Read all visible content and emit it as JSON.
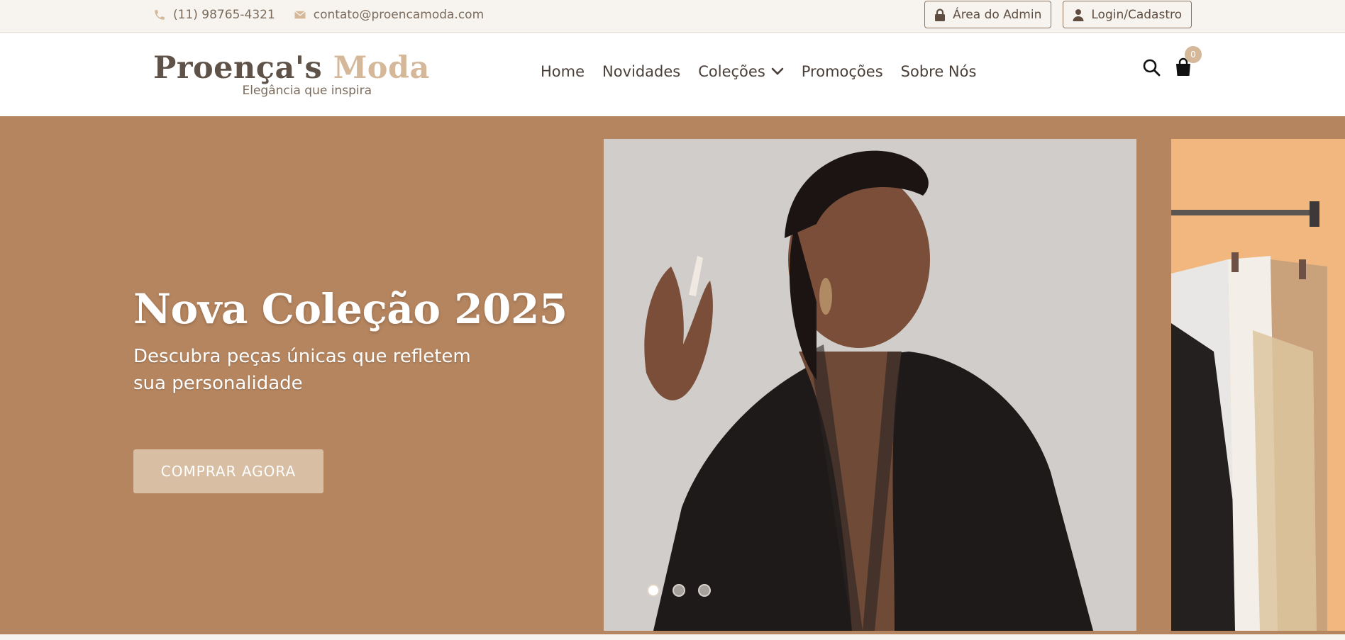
{
  "topbar": {
    "phone": "(11) 98765-4321",
    "email": "contato@proencamoda.com",
    "admin_label": "Área do Admin",
    "login_label": "Login/Cadastro"
  },
  "header": {
    "logo": {
      "name_main": "Proença's",
      "name_accent": "Moda",
      "tagline": "Elegância que inspira"
    },
    "nav": [
      {
        "label": "Home"
      },
      {
        "label": "Novidades"
      },
      {
        "label": "Coleções"
      },
      {
        "label": "Promoções"
      },
      {
        "label": "Sobre Nós"
      }
    ],
    "cart_count": "0",
    "icons": [
      "search-icon",
      "shopping-bag-icon"
    ]
  },
  "hero": {
    "title": "Nova Coleção 2025",
    "subtitle": "Descubra peças únicas que refletem sua personalidade",
    "cta_label": "COMPRAR AGORA",
    "slide_dots": 3,
    "active_slide": 1
  },
  "colors": {
    "accent": "#d5b899",
    "hero_bg": "#b5855f",
    "text_dark": "#4a3f38"
  }
}
